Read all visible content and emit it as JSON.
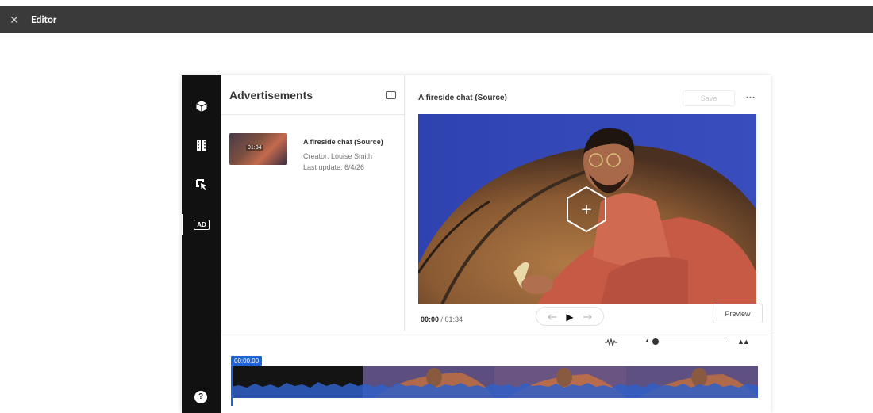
{
  "app": {
    "title": "Editor",
    "close_icon": "close-icon"
  },
  "sidebar": {
    "items": [
      {
        "name": "cube",
        "icon": "cube-icon"
      },
      {
        "name": "film",
        "icon": "film-icon"
      },
      {
        "name": "interactive",
        "icon": "cursor-icon"
      },
      {
        "name": "ads",
        "icon": "ad-icon",
        "label": "AD",
        "active": true
      }
    ],
    "help_label": "?"
  },
  "panel": {
    "title": "Advertisements",
    "items": [
      {
        "title": "A fireside chat (Source)",
        "duration": "01:34",
        "creator": "Creator: Louise Smith",
        "updated": "Last update: 6/4/26"
      }
    ]
  },
  "player": {
    "title": "A fireside chat (Source)",
    "save_label": "Save",
    "more_label": "···",
    "current_time": "00:00",
    "separator": " / ",
    "total_time": "01:34",
    "preview_label": "Preview"
  },
  "timeline": {
    "timecode": "00:00.00",
    "zoom_level": 0.0
  },
  "colors": {
    "accent": "#1f63d6",
    "rail": "#111111",
    "topbar": "#3a3a3a"
  }
}
